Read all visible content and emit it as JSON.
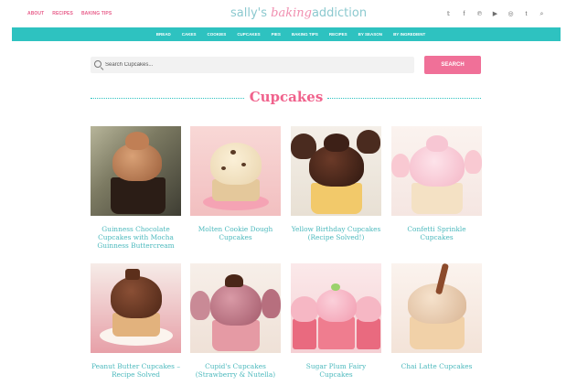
{
  "top_links": [
    "ABOUT",
    "RECIPES",
    "BAKING TIPS"
  ],
  "logo": {
    "part1": "sally's ",
    "part2": "baking",
    "part3": "addiction"
  },
  "social_icons": [
    "twitter-icon",
    "facebook-icon",
    "pinterest-icon",
    "youtube-icon",
    "instagram-icon",
    "tumblr-icon",
    "search-icon"
  ],
  "social_glyphs": [
    "𝕥",
    "f",
    "℗",
    "▶",
    "◎",
    "t",
    "⌕"
  ],
  "nav": [
    "BREAD",
    "CAKES",
    "COOKIES",
    "CUPCAKES",
    "PIES",
    "BAKING TIPS",
    "RECIPES",
    "BY SEASON",
    "BY INGREDIENT"
  ],
  "search": {
    "placeholder": "Search Cupcakes...",
    "button": "SEARCH"
  },
  "page_title": "Cupcakes",
  "recipes": [
    {
      "title": "Guinness Chocolate Cupcakes with Mocha Guinness Buttercream"
    },
    {
      "title": "Molten Cookie Dough Cupcakes"
    },
    {
      "title": "Yellow Birthday Cupcakes (Recipe Solved!)"
    },
    {
      "title": "Confetti Sprinkle Cupcakes"
    },
    {
      "title": "Peanut Butter Cupcakes – Recipe Solved"
    },
    {
      "title": "Cupid's Cupcakes (Strawberry & Nutella)"
    },
    {
      "title": "Sugar Plum Fairy Cupcakes"
    },
    {
      "title": "Chai Latte Cupcakes"
    }
  ],
  "colors": {
    "accent_pink": "#f0628c",
    "accent_teal": "#2ec2c0"
  }
}
